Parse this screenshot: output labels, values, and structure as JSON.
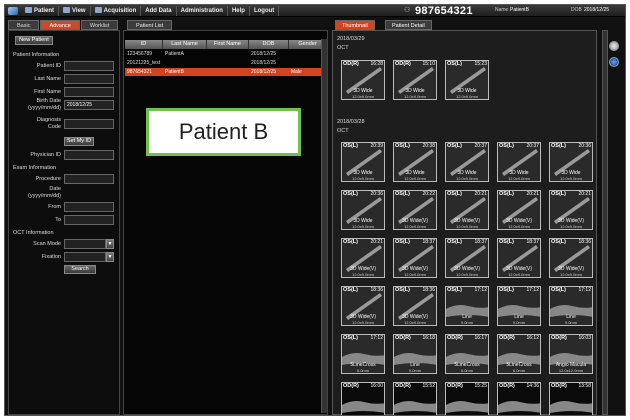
{
  "menubar": {
    "items": [
      "Patient",
      "View",
      "Acquisition",
      "Add Data",
      "Administration",
      "Help",
      "Logout"
    ],
    "patient_id": "987654321",
    "name_label": "Name",
    "patient_name": "PatientB",
    "dob_label": "DOB",
    "dob": "2018/12/25"
  },
  "search": {
    "tabs": [
      "Basic",
      "Advance",
      "Worklist"
    ],
    "active_tab": "Advance",
    "new_patient": "New Patient",
    "patient_info_title": "Patient Information",
    "patient_id_label": "Patient ID",
    "last_name_label": "Last Name",
    "first_name_label": "First Name",
    "birth_date_label_1": "Birth Date",
    "birth_date_label_2": "(yyyy/mm/dd)",
    "birth_date_value": "2018/12/25",
    "diagnosis_label_1": "Diagnosis",
    "diagnosis_label_2": "Code",
    "set_my_id": "Set My ID",
    "physician_label": "Physician ID",
    "exam_info_title": "Exam Information",
    "procedure_label": "Procedure",
    "date_label_1": "Date",
    "date_label_2": "(yyyy/mm/dd)",
    "from_label": "From",
    "to_label": "To",
    "oct_info_title": "OCT Information",
    "scan_mode_label": "Scan Mode",
    "fixation_label": "Fixation",
    "search_button": "Search"
  },
  "patient_list": {
    "tab": "Patient List",
    "columns": [
      "ID",
      "Last Name",
      "First Name",
      "DOB",
      "Gender"
    ],
    "rows": [
      {
        "id": "123456789",
        "last": "PatientA",
        "first": "",
        "dob": "2018/12/25",
        "gender": ""
      },
      {
        "id": "20121225_test",
        "last": "",
        "first": "",
        "dob": "2018/12/25",
        "gender": ""
      },
      {
        "id": "987654321",
        "last": "PatientB",
        "first": "",
        "dob": "2018/12/25",
        "gender": "Male"
      }
    ],
    "selected_index": 2
  },
  "overlay_label": "Patient B",
  "right": {
    "tabs": [
      "Thumbnail",
      "Patient Detail"
    ],
    "active_tab": "Thumbnail",
    "groups": [
      {
        "date": "2018/03/29",
        "modality": "OCT",
        "thumbs": [
          {
            "eye": "OD(R)",
            "time": "16:28",
            "title": "3D Wide",
            "sub": "12.0x9.0mm"
          },
          {
            "eye": "OD(R)",
            "time": "15:10",
            "title": "3D Wide",
            "sub": "12.0x9.0mm"
          },
          {
            "eye": "OS(L)",
            "time": "15:23",
            "title": "3D Wide",
            "sub": "12.0x9.0mm"
          }
        ]
      },
      {
        "date": "2018/03/28",
        "modality": "OCT",
        "thumbs": [
          {
            "eye": "OS(L)",
            "time": "20:39",
            "title": "3D Wide",
            "sub": "12.0x9.0mm"
          },
          {
            "eye": "OS(L)",
            "time": "20:38",
            "title": "3D Wide",
            "sub": "12.0x9.0mm"
          },
          {
            "eye": "OS(L)",
            "time": "20:37",
            "title": "3D Wide",
            "sub": "12.0x9.0mm"
          },
          {
            "eye": "OS(L)",
            "time": "20:37",
            "title": "3D Wide",
            "sub": "12.0x9.0mm"
          },
          {
            "eye": "OS(L)",
            "time": "20:36",
            "title": "3D Wide",
            "sub": "12.0x9.0mm"
          },
          {
            "eye": "OS(L)",
            "time": "20:36",
            "title": "3D Wide",
            "sub": "12.0x9.0mm"
          },
          {
            "eye": "OS(L)",
            "time": "20:22",
            "title": "3D Wide(V)",
            "sub": "12.0x9.0mm"
          },
          {
            "eye": "OS(L)",
            "time": "20:21",
            "title": "3D Wide(V)",
            "sub": "12.0x9.0mm"
          },
          {
            "eye": "OS(L)",
            "time": "20:21",
            "title": "3D Wide(V)",
            "sub": "12.0x9.0mm"
          },
          {
            "eye": "OS(L)",
            "time": "20:21",
            "title": "3D Wide(V)",
            "sub": "12.0x9.0mm"
          },
          {
            "eye": "OS(L)",
            "time": "20:21",
            "title": "3D Wide(V)",
            "sub": "12.0x9.0mm"
          },
          {
            "eye": "OS(L)",
            "time": "18:37",
            "title": "3D Wide(V)",
            "sub": "12.0x9.0mm"
          },
          {
            "eye": "OS(L)",
            "time": "18:37",
            "title": "3D Wide(V)",
            "sub": "12.0x9.0mm"
          },
          {
            "eye": "OS(L)",
            "time": "18:37",
            "title": "3D Wide(V)",
            "sub": "12.0x9.0mm"
          },
          {
            "eye": "OS(L)",
            "time": "18:36",
            "title": "3D Wide(V)",
            "sub": "12.0x9.0mm"
          },
          {
            "eye": "OS(L)",
            "time": "18:36",
            "title": "3D Wide(V)",
            "sub": "12.0x9.0mm"
          },
          {
            "eye": "OS(L)",
            "time": "18:36",
            "title": "3D Wide(V)",
            "sub": "12.0x9.0mm"
          },
          {
            "eye": "OS(L)",
            "time": "17:12",
            "title": "Line",
            "sub": "9.0mm"
          },
          {
            "eye": "OS(L)",
            "time": "17:12",
            "title": "Line",
            "sub": "9.0mm"
          },
          {
            "eye": "OS(L)",
            "time": "17:12",
            "title": "Line",
            "sub": "9.0mm"
          },
          {
            "eye": "OS(L)",
            "time": "17:12",
            "title": "5LineCross",
            "sub": "6.0mm"
          },
          {
            "eye": "OD(R)",
            "time": "16:18",
            "title": "Line",
            "sub": "9.0mm"
          },
          {
            "eye": "OD(R)",
            "time": "16:17",
            "title": "5LineCross",
            "sub": "6.0mm"
          },
          {
            "eye": "OD(R)",
            "time": "16:12",
            "title": "5LineCross",
            "sub": "6.0mm"
          },
          {
            "eye": "OD(R)",
            "time": "16:03",
            "title": "Angio Macula",
            "sub": "12.0x12.0mm"
          },
          {
            "eye": "OD(R)",
            "time": "16:00",
            "title": "",
            "sub": ""
          },
          {
            "eye": "OD(R)",
            "time": "15:52",
            "title": "",
            "sub": ""
          },
          {
            "eye": "OD(R)",
            "time": "15:25",
            "title": "",
            "sub": ""
          },
          {
            "eye": "OD(R)",
            "time": "14:36",
            "title": "",
            "sub": ""
          },
          {
            "eye": "OD(R)",
            "time": "13:58",
            "title": "",
            "sub": ""
          }
        ]
      }
    ]
  }
}
